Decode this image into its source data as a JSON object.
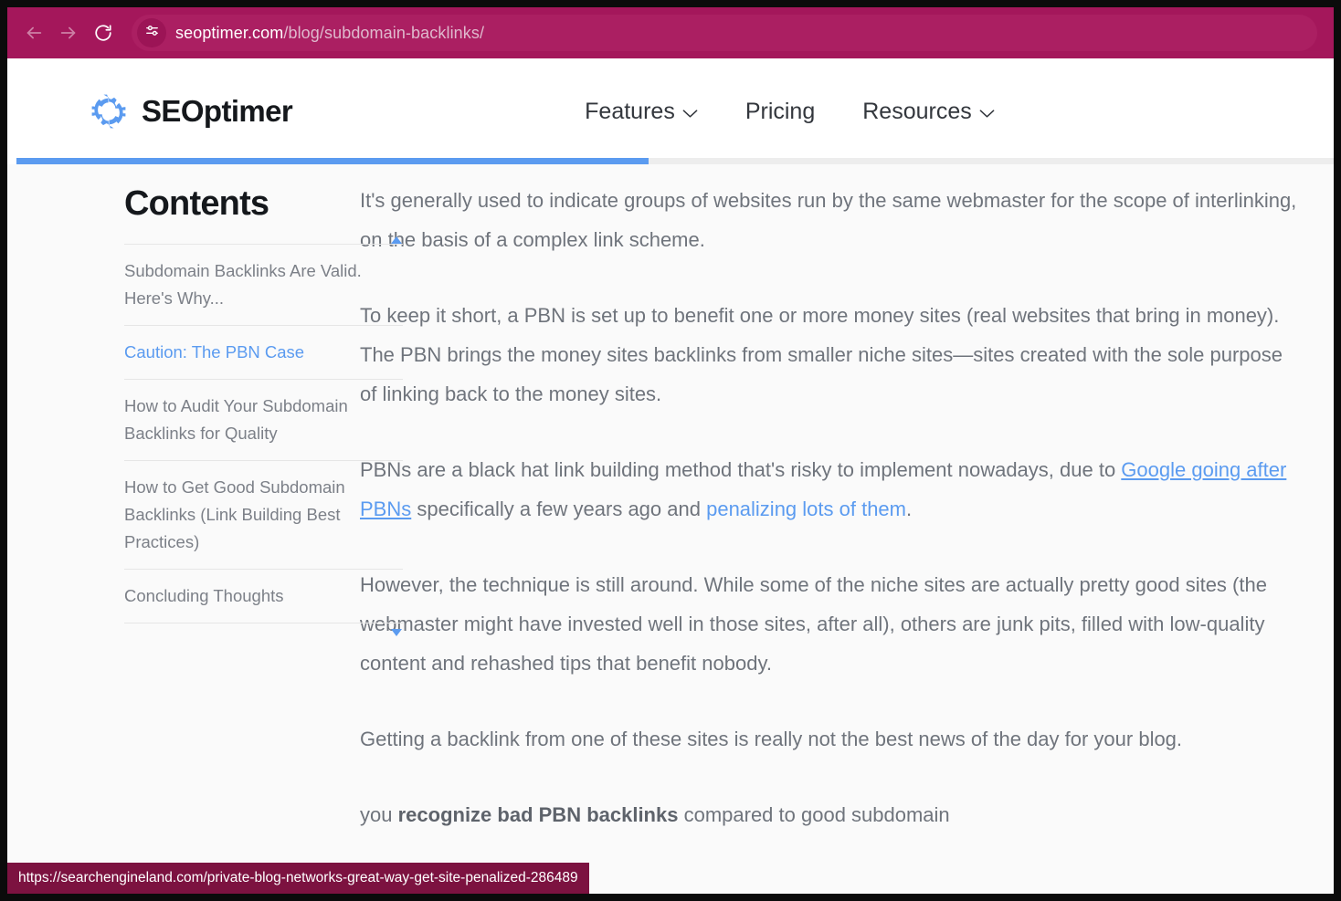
{
  "browser": {
    "back_label": "Back",
    "forward_label": "Forward",
    "reload_label": "Reload",
    "site_info_label": "View site information",
    "url_domain": "seoptimer.com",
    "url_path": "/blog/subdomain-backlinks/",
    "toolbar_color": "#a4175b",
    "omnibox_color": "#ab1f62"
  },
  "status_bar": {
    "url": "https://searchengineland.com/private-blog-networks-great-way-get-site-penalized-286489",
    "background": "#7c1240"
  },
  "site": {
    "logo_text": "SEOptimer",
    "logo_color": "#5b9bf0",
    "nav": [
      {
        "label": "Features",
        "has_dropdown": true
      },
      {
        "label": "Pricing",
        "has_dropdown": false
      },
      {
        "label": "Resources",
        "has_dropdown": true
      }
    ],
    "progress_percent": 48,
    "progress_color": "#5b9bf0"
  },
  "toc": {
    "title": "Contents",
    "scroll_up_icon": "triangle-up-icon",
    "scroll_down_icon": "triangle-down-icon",
    "active_color": "#5b9bf0",
    "items": [
      {
        "label": "Subdomain Backlinks Are Valid. Here's Why...",
        "active": false
      },
      {
        "label": "Caution: The PBN Case",
        "active": true
      },
      {
        "label": "How to Audit Your Subdomain Backlinks for Quality",
        "active": false
      },
      {
        "label": "How to Get Good Subdomain Backlinks (Link Building Best Practices)",
        "active": false
      },
      {
        "label": "Concluding Thoughts",
        "active": false
      }
    ]
  },
  "article": {
    "paragraph_1": "It's generally used to indicate groups of websites run by the same webmaster for the scope of interlinking, on the basis of a complex link scheme.",
    "paragraph_2": "To keep it short, a PBN is set up to benefit one or more money sites (real websites that bring in money). The PBN brings the money sites backlinks from smaller niche sites—sites created with the sole purpose of linking back to the money sites.",
    "paragraph_3": {
      "part_1": "PBNs are a black hat link building method that's risky to implement nowadays, due to ",
      "link_1": "Google going after PBNs",
      "part_2": " specifically a few years ago and ",
      "link_2": "penalizing lots of them",
      "part_3": "."
    },
    "paragraph_4": "However, the technique is still around. While some of the niche sites are actually pretty good sites (the webmaster might have invested well in those sites, after all), others are junk pits, filled with low-quality content and rehashed tips that benefit nobody.",
    "paragraph_5": "Getting a backlink from one of these sites is really not the best news of the day for your blog.",
    "paragraph_6": {
      "part_1": " you ",
      "bold": "recognize bad PBN backlinks",
      "part_2": " compared to good subdomain"
    }
  }
}
